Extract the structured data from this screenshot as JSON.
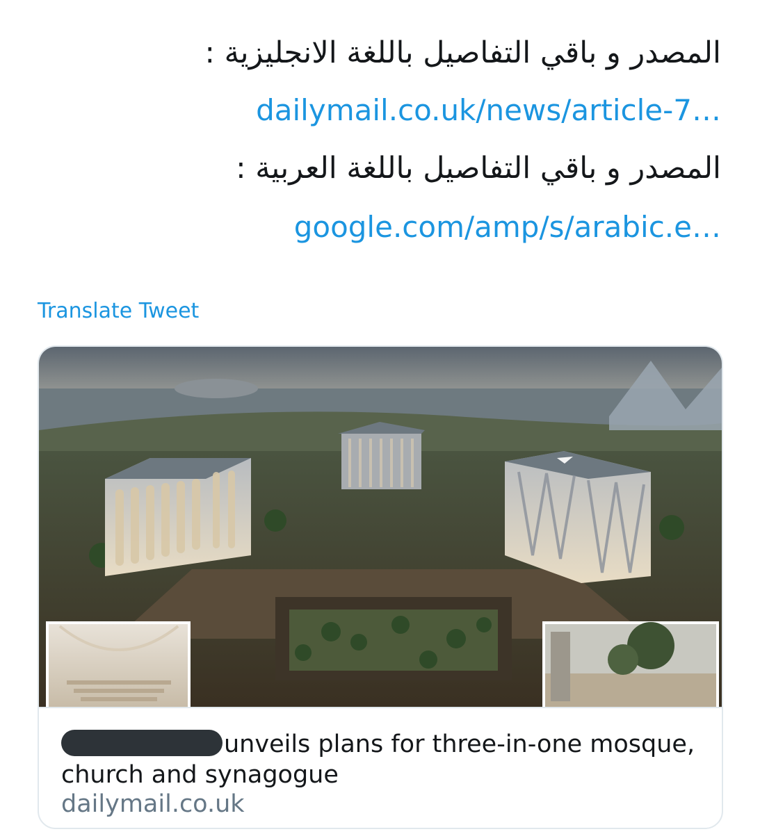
{
  "tweet": {
    "lines": [
      "المصدر و باقي التفاصيل باللغة الانجليزية :",
      "dailymail.co.uk/news/article-7…",
      "المصدر و باقي التفاصيل باللغة العربية :",
      "google.com/amp/s/arabic.e…"
    ],
    "translate_label": "Translate Tweet"
  },
  "card": {
    "title": "unveils plans for three-in-one mosque, church and synagogue",
    "domain": "dailymail.co.uk"
  },
  "colors": {
    "link": "#1b95e0",
    "text": "#14171a",
    "muted": "#657786",
    "border": "#e1e8ed"
  }
}
